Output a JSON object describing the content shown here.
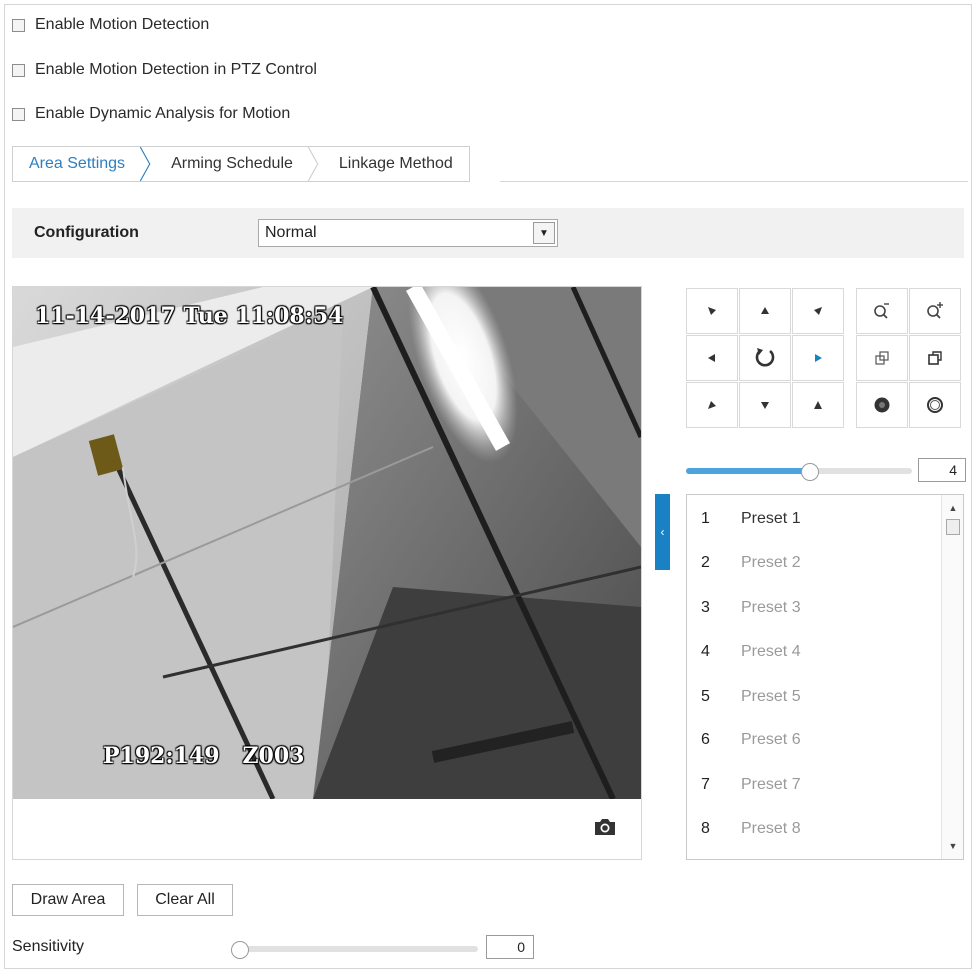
{
  "options": {
    "motion_detection": "Enable Motion Detection",
    "motion_in_ptz": "Enable Motion Detection in PTZ Control",
    "dynamic_analysis": "Enable Dynamic Analysis for Motion"
  },
  "tabs": [
    {
      "label": "Area Settings",
      "active": true
    },
    {
      "label": "Arming Schedule",
      "active": false
    },
    {
      "label": "Linkage Method",
      "active": false
    }
  ],
  "config": {
    "label": "Configuration",
    "selected": "Normal"
  },
  "video": {
    "timestamp": "11-14-2017 Tue 11:08:54",
    "channel_label": "P192:149   Z003"
  },
  "ptz": {
    "speed_value": "4",
    "speed_level": 0.55
  },
  "presets": [
    {
      "num": "1",
      "name": "Preset 1"
    },
    {
      "num": "2",
      "name": "Preset 2"
    },
    {
      "num": "3",
      "name": "Preset 3"
    },
    {
      "num": "4",
      "name": "Preset 4"
    },
    {
      "num": "5",
      "name": "Preset 5"
    },
    {
      "num": "6",
      "name": "Preset 6"
    },
    {
      "num": "7",
      "name": "Preset 7"
    },
    {
      "num": "8",
      "name": "Preset 8"
    }
  ],
  "actions": {
    "draw_area": "Draw Area",
    "clear_all": "Clear All"
  },
  "sensitivity": {
    "label": "Sensitivity",
    "value": "0",
    "level": 0
  },
  "colors": {
    "accent": "#2d7fc1",
    "slider_fill": "#4da3dd",
    "collapse_tab": "#1a82c4"
  }
}
